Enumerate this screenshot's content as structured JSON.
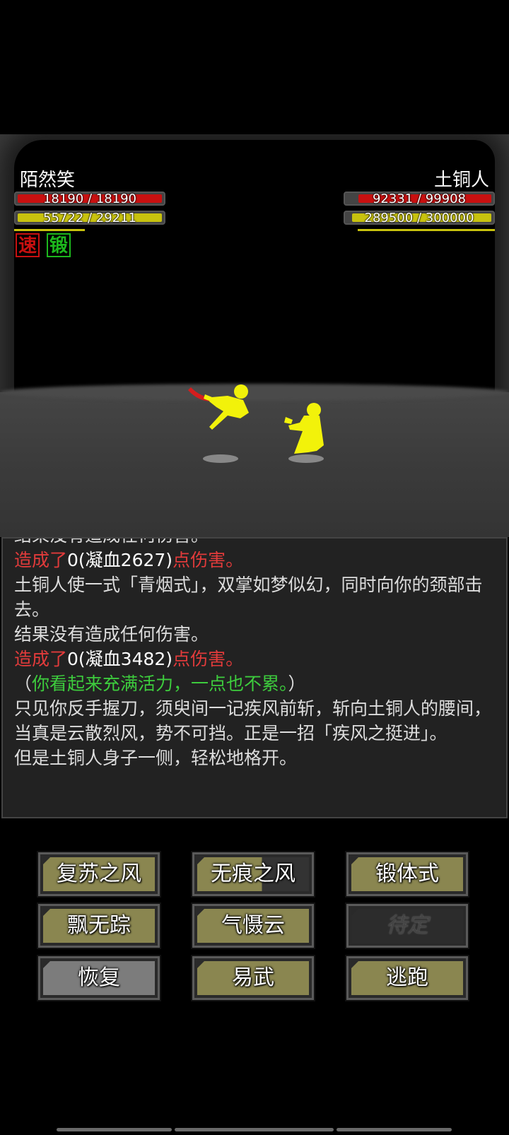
{
  "player": {
    "name": "陌然笑",
    "hp_text": "18190 / 18190",
    "hp_fraction": 1.0,
    "mp_text": "55722 / 29211",
    "mp_fraction": 1.0,
    "status_icons": [
      {
        "char": "速",
        "color": "#c81010"
      },
      {
        "char": "锻",
        "color": "#1db81d"
      }
    ]
  },
  "enemy": {
    "name": "土铜人",
    "hp_text": "92331 / 99908",
    "hp_fraction": 0.92,
    "mp_text": "289500 / 300000",
    "mp_fraction": 0.965
  },
  "log": [
    {
      "parts": [
        {
          "t": "结果没有造成任何伤害。",
          "c": ""
        }
      ]
    },
    {
      "parts": [
        {
          "t": "造成了",
          "c": "red"
        },
        {
          "t": "0(凝血2627)",
          "c": "white"
        },
        {
          "t": "点伤害。",
          "c": "red"
        }
      ]
    },
    {
      "parts": [
        {
          "t": "土铜人使一式「青烟式」，双掌如梦似幻，同时向你的颈部击去。",
          "c": ""
        }
      ]
    },
    {
      "parts": [
        {
          "t": "结果没有造成任何伤害。",
          "c": ""
        }
      ]
    },
    {
      "parts": [
        {
          "t": "造成了",
          "c": "red"
        },
        {
          "t": "0(凝血3482)",
          "c": "white"
        },
        {
          "t": "点伤害。",
          "c": "red"
        }
      ]
    },
    {
      "parts": [
        {
          "t": "（",
          "c": ""
        },
        {
          "t": "你看起来充满活力，一点也不累。",
          "c": "green"
        },
        {
          "t": "）",
          "c": ""
        }
      ]
    },
    {
      "parts": [
        {
          "t": "只见你反手握刀，须臾间一记疾风前斩，斩向土铜人的腰间，当真是云散烈风，势不可挡。正是一招「疾风之挺进」。",
          "c": ""
        }
      ]
    },
    {
      "parts": [
        {
          "t": "但是土铜人身子一侧，轻松地格开。",
          "c": ""
        }
      ]
    }
  ],
  "actions": [
    {
      "label": "复苏之风",
      "state": "ready"
    },
    {
      "label": "无痕之风",
      "state": "partial"
    },
    {
      "label": "锻体式",
      "state": "ready"
    },
    {
      "label": "飘无踪",
      "state": "ready"
    },
    {
      "label": "气慑云",
      "state": "ready"
    },
    {
      "label": "待定",
      "state": "disabled"
    },
    {
      "label": "恢复",
      "state": "grey"
    },
    {
      "label": "易武",
      "state": "ready"
    },
    {
      "label": "逃跑",
      "state": "ready"
    }
  ],
  "colors": {
    "hp": "#c81010",
    "mp": "#c8c20e",
    "button": "#8a8650",
    "highlight_red": "#e23b3b",
    "highlight_green": "#3dcc3d"
  }
}
